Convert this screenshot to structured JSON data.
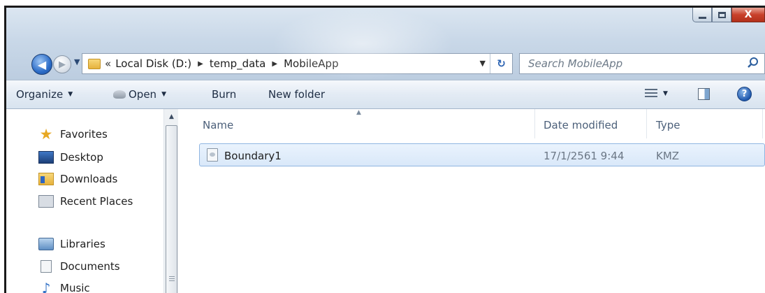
{
  "address_bar": {
    "overflow": "«",
    "crumbs": [
      "Local Disk (D:)",
      "temp_data",
      "MobileApp"
    ]
  },
  "search": {
    "placeholder": "Search MobileApp"
  },
  "toolbar": {
    "organize": "Organize",
    "open": "Open",
    "burn": "Burn",
    "new_folder": "New folder"
  },
  "nav_pane": {
    "favorites": {
      "header": "Favorites",
      "items": [
        "Desktop",
        "Downloads",
        "Recent Places"
      ]
    },
    "libraries": {
      "header": "Libraries",
      "items": [
        "Documents",
        "Music"
      ]
    }
  },
  "columns": {
    "name": "Name",
    "date": "Date modified",
    "type": "Type"
  },
  "files": [
    {
      "name": "Boundary1",
      "date": "17/1/2561 9:44",
      "type": "KMZ"
    }
  ],
  "icons": {
    "favorites": "star-icon",
    "desktop": "desktop-icon",
    "downloads": "downloads-folder-icon",
    "recent": "recent-places-icon",
    "libraries": "libraries-icon",
    "documents": "documents-icon",
    "music": "music-icon",
    "file": "file-icon"
  },
  "colors": {
    "selection": "#d9e8f9",
    "close_button": "#c8412b",
    "header_text": "#4c607a"
  }
}
